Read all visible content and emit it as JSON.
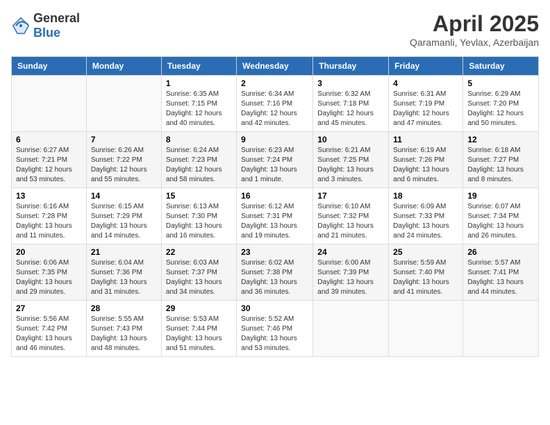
{
  "logo": {
    "general": "General",
    "blue": "Blue"
  },
  "title": "April 2025",
  "subtitle": "Qaramanli, Yevlax, Azerbaijan",
  "weekdays": [
    "Sunday",
    "Monday",
    "Tuesday",
    "Wednesday",
    "Thursday",
    "Friday",
    "Saturday"
  ],
  "weeks": [
    [
      {
        "day": "",
        "sunrise": "",
        "sunset": "",
        "daylight": ""
      },
      {
        "day": "",
        "sunrise": "",
        "sunset": "",
        "daylight": ""
      },
      {
        "day": "1",
        "sunrise": "Sunrise: 6:35 AM",
        "sunset": "Sunset: 7:15 PM",
        "daylight": "Daylight: 12 hours and 40 minutes."
      },
      {
        "day": "2",
        "sunrise": "Sunrise: 6:34 AM",
        "sunset": "Sunset: 7:16 PM",
        "daylight": "Daylight: 12 hours and 42 minutes."
      },
      {
        "day": "3",
        "sunrise": "Sunrise: 6:32 AM",
        "sunset": "Sunset: 7:18 PM",
        "daylight": "Daylight: 12 hours and 45 minutes."
      },
      {
        "day": "4",
        "sunrise": "Sunrise: 6:31 AM",
        "sunset": "Sunset: 7:19 PM",
        "daylight": "Daylight: 12 hours and 47 minutes."
      },
      {
        "day": "5",
        "sunrise": "Sunrise: 6:29 AM",
        "sunset": "Sunset: 7:20 PM",
        "daylight": "Daylight: 12 hours and 50 minutes."
      }
    ],
    [
      {
        "day": "6",
        "sunrise": "Sunrise: 6:27 AM",
        "sunset": "Sunset: 7:21 PM",
        "daylight": "Daylight: 12 hours and 53 minutes."
      },
      {
        "day": "7",
        "sunrise": "Sunrise: 6:26 AM",
        "sunset": "Sunset: 7:22 PM",
        "daylight": "Daylight: 12 hours and 55 minutes."
      },
      {
        "day": "8",
        "sunrise": "Sunrise: 6:24 AM",
        "sunset": "Sunset: 7:23 PM",
        "daylight": "Daylight: 12 hours and 58 minutes."
      },
      {
        "day": "9",
        "sunrise": "Sunrise: 6:23 AM",
        "sunset": "Sunset: 7:24 PM",
        "daylight": "Daylight: 13 hours and 1 minute."
      },
      {
        "day": "10",
        "sunrise": "Sunrise: 6:21 AM",
        "sunset": "Sunset: 7:25 PM",
        "daylight": "Daylight: 13 hours and 3 minutes."
      },
      {
        "day": "11",
        "sunrise": "Sunrise: 6:19 AM",
        "sunset": "Sunset: 7:26 PM",
        "daylight": "Daylight: 13 hours and 6 minutes."
      },
      {
        "day": "12",
        "sunrise": "Sunrise: 6:18 AM",
        "sunset": "Sunset: 7:27 PM",
        "daylight": "Daylight: 13 hours and 8 minutes."
      }
    ],
    [
      {
        "day": "13",
        "sunrise": "Sunrise: 6:16 AM",
        "sunset": "Sunset: 7:28 PM",
        "daylight": "Daylight: 13 hours and 11 minutes."
      },
      {
        "day": "14",
        "sunrise": "Sunrise: 6:15 AM",
        "sunset": "Sunset: 7:29 PM",
        "daylight": "Daylight: 13 hours and 14 minutes."
      },
      {
        "day": "15",
        "sunrise": "Sunrise: 6:13 AM",
        "sunset": "Sunset: 7:30 PM",
        "daylight": "Daylight: 13 hours and 16 minutes."
      },
      {
        "day": "16",
        "sunrise": "Sunrise: 6:12 AM",
        "sunset": "Sunset: 7:31 PM",
        "daylight": "Daylight: 13 hours and 19 minutes."
      },
      {
        "day": "17",
        "sunrise": "Sunrise: 6:10 AM",
        "sunset": "Sunset: 7:32 PM",
        "daylight": "Daylight: 13 hours and 21 minutes."
      },
      {
        "day": "18",
        "sunrise": "Sunrise: 6:09 AM",
        "sunset": "Sunset: 7:33 PM",
        "daylight": "Daylight: 13 hours and 24 minutes."
      },
      {
        "day": "19",
        "sunrise": "Sunrise: 6:07 AM",
        "sunset": "Sunset: 7:34 PM",
        "daylight": "Daylight: 13 hours and 26 minutes."
      }
    ],
    [
      {
        "day": "20",
        "sunrise": "Sunrise: 6:06 AM",
        "sunset": "Sunset: 7:35 PM",
        "daylight": "Daylight: 13 hours and 29 minutes."
      },
      {
        "day": "21",
        "sunrise": "Sunrise: 6:04 AM",
        "sunset": "Sunset: 7:36 PM",
        "daylight": "Daylight: 13 hours and 31 minutes."
      },
      {
        "day": "22",
        "sunrise": "Sunrise: 6:03 AM",
        "sunset": "Sunset: 7:37 PM",
        "daylight": "Daylight: 13 hours and 34 minutes."
      },
      {
        "day": "23",
        "sunrise": "Sunrise: 6:02 AM",
        "sunset": "Sunset: 7:38 PM",
        "daylight": "Daylight: 13 hours and 36 minutes."
      },
      {
        "day": "24",
        "sunrise": "Sunrise: 6:00 AM",
        "sunset": "Sunset: 7:39 PM",
        "daylight": "Daylight: 13 hours and 39 minutes."
      },
      {
        "day": "25",
        "sunrise": "Sunrise: 5:59 AM",
        "sunset": "Sunset: 7:40 PM",
        "daylight": "Daylight: 13 hours and 41 minutes."
      },
      {
        "day": "26",
        "sunrise": "Sunrise: 5:57 AM",
        "sunset": "Sunset: 7:41 PM",
        "daylight": "Daylight: 13 hours and 44 minutes."
      }
    ],
    [
      {
        "day": "27",
        "sunrise": "Sunrise: 5:56 AM",
        "sunset": "Sunset: 7:42 PM",
        "daylight": "Daylight: 13 hours and 46 minutes."
      },
      {
        "day": "28",
        "sunrise": "Sunrise: 5:55 AM",
        "sunset": "Sunset: 7:43 PM",
        "daylight": "Daylight: 13 hours and 48 minutes."
      },
      {
        "day": "29",
        "sunrise": "Sunrise: 5:53 AM",
        "sunset": "Sunset: 7:44 PM",
        "daylight": "Daylight: 13 hours and 51 minutes."
      },
      {
        "day": "30",
        "sunrise": "Sunrise: 5:52 AM",
        "sunset": "Sunset: 7:46 PM",
        "daylight": "Daylight: 13 hours and 53 minutes."
      },
      {
        "day": "",
        "sunrise": "",
        "sunset": "",
        "daylight": ""
      },
      {
        "day": "",
        "sunrise": "",
        "sunset": "",
        "daylight": ""
      },
      {
        "day": "",
        "sunrise": "",
        "sunset": "",
        "daylight": ""
      }
    ]
  ]
}
